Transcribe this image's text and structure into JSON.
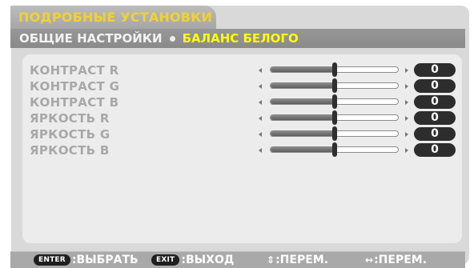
{
  "menu": {
    "tab_title": "ПОДРОБНЫЕ УСТАНОВКИ",
    "breadcrumb": {
      "general": "ОБЩИЕ НАСТРОЙКИ",
      "active": "БАЛАНС БЕЛОГО"
    }
  },
  "settings": [
    {
      "label": "КОНТРАСТ R",
      "value": "0",
      "slider_level": 0.5
    },
    {
      "label": "КОНТРАСТ G",
      "value": "0",
      "slider_level": 0.5
    },
    {
      "label": "КОНТРАСТ B",
      "value": "0",
      "slider_level": 0.5
    },
    {
      "label": "ЯРКОСТЬ R",
      "value": "0",
      "slider_level": 0.5
    },
    {
      "label": "ЯРКОСТЬ G",
      "value": "0",
      "slider_level": 0.5
    },
    {
      "label": "ЯРКОСТЬ B",
      "value": "0",
      "slider_level": 0.5
    }
  ],
  "footer": {
    "enter_key": "ENTER",
    "enter_text": ":ВЫБРАТЬ",
    "exit_key": "EXIT",
    "exit_text": ":ВЫХОД",
    "updown_glyph": "⇕",
    "updown_text": ":ПЕРЕМ.",
    "leftright_glyph": "↔",
    "leftright_text": ":ПЕРЕМ."
  },
  "colors": {
    "tab_title": "#f1d231",
    "active_breadcrumb": "#ffff00",
    "label_disabled": "#a8a8a8",
    "value_pill": "#2d2d2d"
  }
}
